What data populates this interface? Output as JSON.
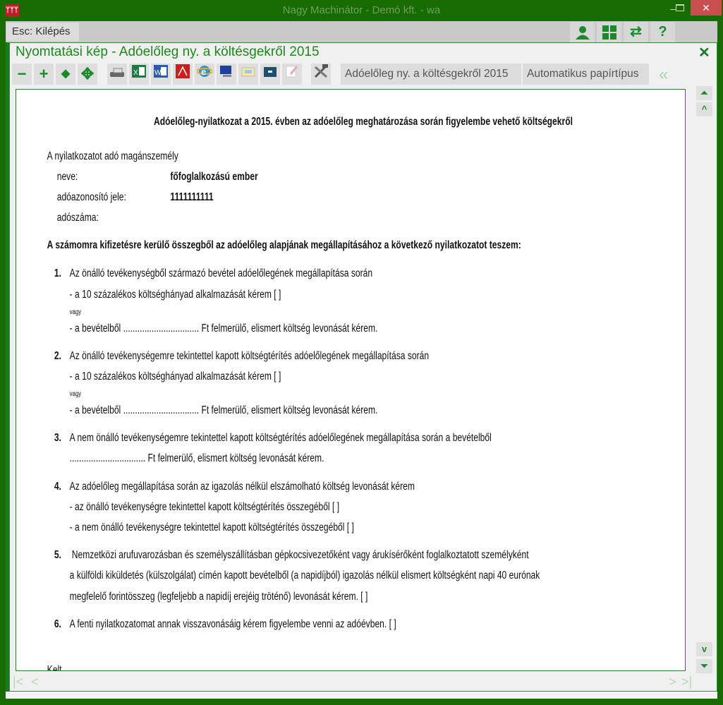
{
  "window": {
    "title": "Nagy Machinátor - Demó kft. - wa",
    "min": "–",
    "close": "✕",
    "logo": "ᛘᛘᛘ"
  },
  "menubar": {
    "esc_label": "Esc: Kilépés",
    "icons": [
      "user-icon",
      "grid-icon",
      "swap-icon",
      "help-icon"
    ],
    "help": "?",
    "swap": "⇄",
    "grid": "▦",
    "user": "👤"
  },
  "panel": {
    "title": "Nyomtatási kép - Adóelőleg ny. a költésgekről 2015",
    "close": "✕"
  },
  "toolbar": {
    "zoom_out": "−",
    "zoom_in": "+",
    "fit_width": "◆",
    "fit_page": "✥",
    "report_label": "Adóelőleg ny. a költésgekről 2015",
    "paper_label": "Automatikus papírtípus",
    "collapse": "«"
  },
  "scroll": {
    "top": "⏶",
    "up": "^",
    "down": "v",
    "bottom": "⏷"
  },
  "pager": {
    "first": "|<",
    "prev": "<",
    "next": ">",
    "last": ">|"
  },
  "document": {
    "title": "Adóelőleg-nyilatkozat a 2015. évben az adóelőleg meghatározása során figyelembe vehető költségekről",
    "person_label": "A nyilatkozatot adó magánszemély",
    "name_label": "neve:",
    "name_value": "főfoglalkozású ember",
    "taxid_label": "adóazonosító jele:",
    "taxid_value": "1111111111",
    "taxnum_label": "adószáma:",
    "heading": "A számomra kifizetésre kerülő összegből az adóelőleg alapjának megállapításához a következő nyilatkozatot teszem:",
    "items": [
      {
        "num": "1.",
        "lines": [
          "Az önálló tevékenységből származó bevétel adóelőlegének megállapítása során",
          "- a 10 százalékos költséghányad alkalmazását kérem [    ]",
          "vagy",
          "- a bevételből ................................ Ft felmerülő, elismert költség levonását kérem."
        ]
      },
      {
        "num": "2.",
        "lines": [
          "Az önálló tevékenységemre tekintettel kapott költségtérítés adóelőlegének megállapítása során",
          "- a 10 százalékos költséghányad alkalmazását kérem [    ]",
          "vagy",
          "- a bevételből ................................ Ft felmerülő, elismert költség levonását kérem."
        ]
      },
      {
        "num": "3.",
        "lines": [
          "A nem önálló tevékenységemre tekintettel kapott költségtérítés adóelőlegének megállapítása során a bevételből",
          "................................ Ft felmerülő, elismert költség levonását kérem."
        ]
      },
      {
        "num": "4.",
        "lines": [
          "Az adóelőleg megállapítása során az igazolás nélkül elszámolható költség levonását kérem",
          "- az önálló tevékenységre tekintettel kapott költségtérítés összegéből [    ]",
          "- a nem önálló tevékenységre tekintettel kapott költségtérítés összegéből [    ]"
        ]
      },
      {
        "num": "5.",
        "lines": [
          "Nemzetközi arufuvarozásban és személyszállításban gépkocsivezetőként vagy árukísérőként foglalkoztatott személyként",
          "a külföldi kiküldetés (külszolgálat) címén kapott bevételből (a napidíjból) igazolás nélkül elismert költségként napi 40 eurónak",
          "megfelelő forintösszeg (legfeljebb a napidíj erejéig tröténő) levonását kérem. [    ]"
        ]
      },
      {
        "num": "6.",
        "lines": [
          "A fenti nyilatkozatomat annak visszavonásáig kérem figyelembe venni az adóévben. [    ]"
        ]
      }
    ],
    "footer_partial": "Kelt"
  }
}
